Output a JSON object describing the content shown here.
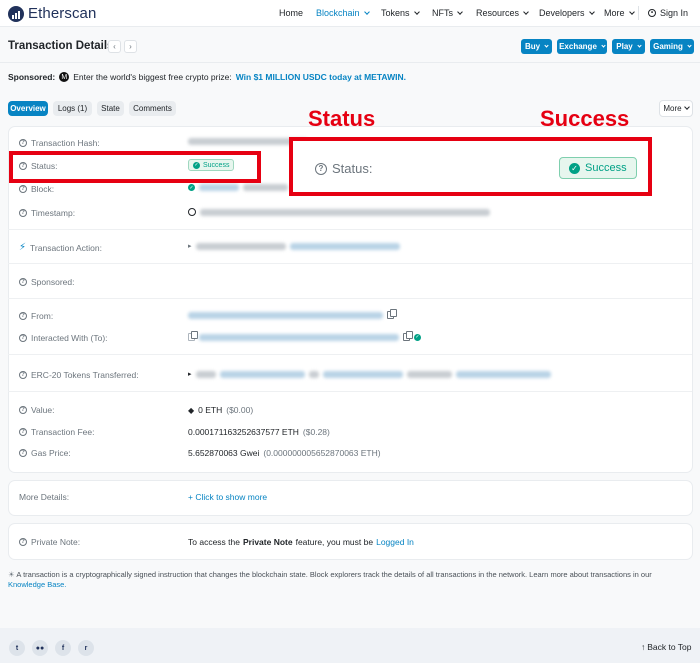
{
  "header": {
    "brand": "Etherscan",
    "nav": [
      {
        "label": "Home",
        "dropdown": false,
        "active": false
      },
      {
        "label": "Blockchain",
        "dropdown": true,
        "active": true
      },
      {
        "label": "Tokens",
        "dropdown": true,
        "active": false
      },
      {
        "label": "NFTs",
        "dropdown": true,
        "active": false
      },
      {
        "label": "Resources",
        "dropdown": true,
        "active": false
      },
      {
        "label": "Developers",
        "dropdown": true,
        "active": false
      },
      {
        "label": "More",
        "dropdown": true,
        "active": false
      }
    ],
    "sign_in": "Sign In"
  },
  "page": {
    "title": "Transaction Details",
    "actions": [
      "Buy",
      "Exchange",
      "Play",
      "Gaming"
    ]
  },
  "sponsored": {
    "label": "Sponsored:",
    "text": "Enter the world's biggest free crypto prize:",
    "promo": "Win $1 MILLION USDC today at METAWIN."
  },
  "tabs": [
    "Overview",
    "Logs (1)",
    "State",
    "Comments"
  ],
  "more_label": "More",
  "details": {
    "tx_hash_label": "Transaction Hash:",
    "status_label": "Status:",
    "status_value": "Success",
    "block_label": "Block:",
    "timestamp_label": "Timestamp:",
    "action_label": "Transaction Action:",
    "sponsored_label": "Sponsored:",
    "from_label": "From:",
    "interacted_label": "Interacted With (To):",
    "erc20_label": "ERC-20 Tokens Transferred:",
    "value_label": "Value:",
    "value": "0 ETH",
    "value_usd": "($0.00)",
    "fee_label": "Transaction Fee:",
    "fee": "0.000171163252637577 ETH",
    "fee_usd": "($0.28)",
    "gas_label": "Gas Price:",
    "gas": "5.652870063 Gwei",
    "gas_eth": "(0.000000005652870063 ETH)"
  },
  "more_details": {
    "label": "More Details:",
    "link": "+ Click to show more"
  },
  "private_note": {
    "label": "Private Note:",
    "text_pre": "To access the",
    "text_bold": "Private Note",
    "text_mid": "feature, you must be",
    "link": "Logged In"
  },
  "info_note": {
    "text": "A transaction is a cryptographically signed instruction that changes the blockchain state. Block explorers track the details of all transactions in the network. Learn more about transactions in our",
    "link": "Knowledge Base."
  },
  "annotation": {
    "left_label": "Status",
    "right_label": "Success",
    "zoom_status": "Status:",
    "zoom_badge": "Success",
    "color": "#e60012"
  },
  "footer": {
    "back_to_top": "Back to Top",
    "social": [
      "twitter-icon",
      "medium-icon",
      "facebook-icon",
      "reddit-icon"
    ]
  },
  "colors": {
    "accent": "#0784c3",
    "success": "#00a186",
    "brand": "#21325b"
  }
}
